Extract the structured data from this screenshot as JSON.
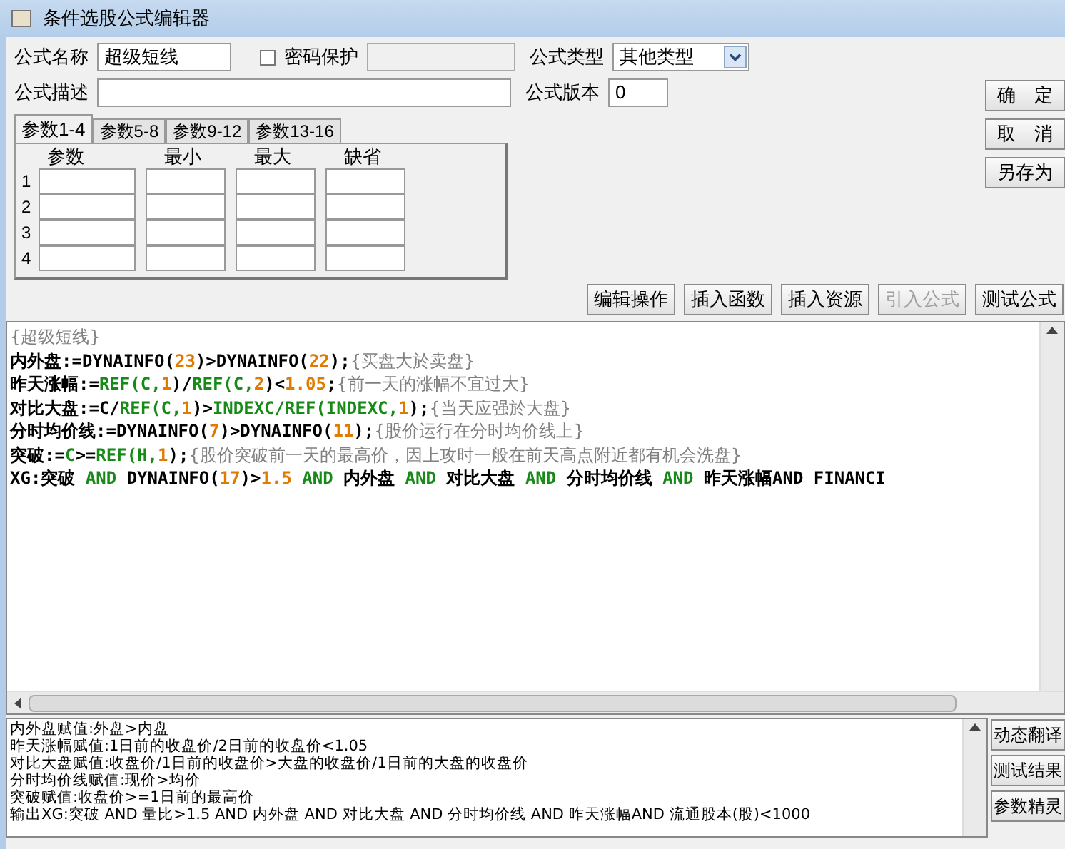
{
  "window": {
    "title": "条件选股公式编辑器"
  },
  "form": {
    "name_label": "公式名称",
    "name_value": "超级短线",
    "password": {
      "label": "密码保护",
      "checked": false
    },
    "type_label": "公式类型",
    "type_value": "其他类型",
    "desc_label": "公式描述",
    "version_label": "公式版本",
    "version_value": "0"
  },
  "side_buttons": [
    "确　定",
    "取　消",
    "另存为"
  ],
  "tabs": [
    {
      "label": "参数1-4",
      "selected": true
    },
    {
      "label": "参数5-8",
      "selected": false
    },
    {
      "label": "参数9-12",
      "selected": false
    },
    {
      "label": "参数13-16",
      "selected": false
    }
  ],
  "params": {
    "columns": [
      "参数",
      "最小",
      "最大",
      "缺省"
    ],
    "rows": [
      "1",
      "2",
      "3",
      "4"
    ]
  },
  "toolbar": [
    {
      "label": "编辑操作",
      "disabled": false
    },
    {
      "label": "插入函数",
      "disabled": false
    },
    {
      "label": "插入资源",
      "disabled": false
    },
    {
      "label": "引入公式",
      "disabled": true
    },
    {
      "label": "测试公式",
      "disabled": false
    }
  ],
  "code_lines": [
    [
      {
        "text": "{超级短线}",
        "kind": "comment"
      }
    ],
    [
      {
        "text": "内外盘:=DYNAINFO(",
        "kind": "plain"
      },
      {
        "text": "23",
        "kind": "number"
      },
      {
        "text": ")>DYNAINFO(",
        "kind": "plain"
      },
      {
        "text": "22",
        "kind": "number"
      },
      {
        "text": ");",
        "kind": "plain"
      },
      {
        "text": "{买盘大於卖盘}",
        "kind": "comment"
      }
    ],
    [
      {
        "text": "昨天涨幅:=",
        "kind": "plain"
      },
      {
        "text": "REF(C,",
        "kind": "function"
      },
      {
        "text": "1",
        "kind": "number"
      },
      {
        "text": ")/",
        "kind": "plain"
      },
      {
        "text": "REF(C,",
        "kind": "function"
      },
      {
        "text": "2",
        "kind": "number"
      },
      {
        "text": ")<",
        "kind": "plain"
      },
      {
        "text": "1.05",
        "kind": "number"
      },
      {
        "text": ";",
        "kind": "plain"
      },
      {
        "text": "{前一天的涨幅不宜过大}",
        "kind": "comment"
      }
    ],
    [
      {
        "text": "对比大盘:=C/",
        "kind": "plain"
      },
      {
        "text": "REF(C,",
        "kind": "function"
      },
      {
        "text": "1",
        "kind": "number"
      },
      {
        "text": ")>",
        "kind": "plain"
      },
      {
        "text": "INDEXC/REF(INDEXC,",
        "kind": "function"
      },
      {
        "text": "1",
        "kind": "number"
      },
      {
        "text": ");",
        "kind": "plain"
      },
      {
        "text": "{当天应强於大盘}",
        "kind": "comment"
      }
    ],
    [
      {
        "text": "分时均价线:=DYNAINFO(",
        "kind": "plain"
      },
      {
        "text": "7",
        "kind": "number"
      },
      {
        "text": ")>DYNAINFO(",
        "kind": "plain"
      },
      {
        "text": "11",
        "kind": "number"
      },
      {
        "text": ");",
        "kind": "plain"
      },
      {
        "text": "{股价运行在分时均价线上}",
        "kind": "comment"
      }
    ],
    [
      {
        "text": "突破:=",
        "kind": "plain"
      },
      {
        "text": "C",
        "kind": "function"
      },
      {
        "text": ">=",
        "kind": "plain"
      },
      {
        "text": "REF(H,",
        "kind": "function"
      },
      {
        "text": "1",
        "kind": "number"
      },
      {
        "text": ");",
        "kind": "plain"
      },
      {
        "text": "{股价突破前一天的最高价，因上攻时一般在前天高点附近都有机会洗盘}",
        "kind": "comment"
      }
    ],
    [
      {
        "text": "XG:突破 ",
        "kind": "plain"
      },
      {
        "text": "AND",
        "kind": "function"
      },
      {
        "text": " DYNAINFO(",
        "kind": "plain"
      },
      {
        "text": "17",
        "kind": "number"
      },
      {
        "text": ")>",
        "kind": "plain"
      },
      {
        "text": "1.5",
        "kind": "number"
      },
      {
        "text": " AND",
        "kind": "function"
      },
      {
        "text": " 内外盘 ",
        "kind": "plain"
      },
      {
        "text": "AND",
        "kind": "function"
      },
      {
        "text": " 对比大盘 ",
        "kind": "plain"
      },
      {
        "text": "AND",
        "kind": "function"
      },
      {
        "text": " 分时均价线 ",
        "kind": "plain"
      },
      {
        "text": "AND",
        "kind": "function"
      },
      {
        "text": " 昨天涨幅AND FINANCI",
        "kind": "plain"
      }
    ]
  ],
  "output_lines": [
    "内外盘赋值:外盘>内盘",
    "昨天涨幅赋值:1日前的收盘价/2日前的收盘价<1.05",
    "对比大盘赋值:收盘价/1日前的收盘价>大盘的收盘价/1日前的大盘的收盘价",
    "分时均价线赋值:现价>均价",
    "突破赋值:收盘价>=1日前的最高价",
    "输出XG:突破 AND 量比>1.5 AND 内外盘 AND 对比大盘 AND 分时均价线 AND 昨天涨幅AND 流通股本(股)<1000"
  ],
  "output_buttons": [
    "动态翻译",
    "测试结果",
    "参数精灵"
  ]
}
